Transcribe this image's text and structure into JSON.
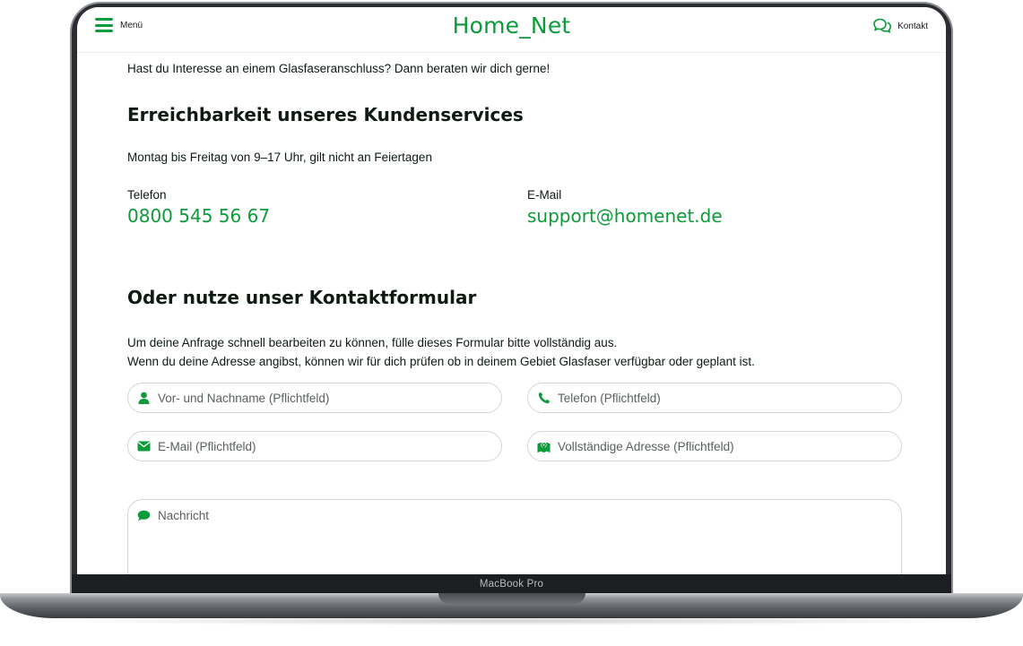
{
  "device": {
    "model_label": "MacBook Pro"
  },
  "header": {
    "menu_label": "Menü",
    "logo": "Home_Net",
    "contact_label": "Kontakt",
    "menu_icon": "hamburger-icon",
    "contact_icon": "chat-bubbles-icon"
  },
  "intro_text": "Hast du Interesse an einem Glasfaseranschluss? Dann beraten wir dich gerne!",
  "service": {
    "heading": "Erreichbarkeit unseres Kundenservices",
    "hours": "Montag bis Freitag von 9–17 Uhr, gilt nicht an Feiertagen",
    "phone_caption": "Telefon",
    "phone_value": "0800 545 56 67",
    "email_caption": "E-Mail",
    "email_value": "support@homenet.de"
  },
  "form": {
    "heading": "Oder nutze unser Kontaktformular",
    "description_line1": "Um deine Anfrage schnell bearbeiten zu können, fülle dieses Formular bitte vollständig aus.",
    "description_line2": "Wenn du deine Adresse angibst, können wir für dich prüfen ob in deinem Gebiet Glasfaser verfügbar oder geplant ist.",
    "fields": [
      {
        "placeholder": "Vor- und Nachname (Pflichtfeld)",
        "icon": "user-icon",
        "value": ""
      },
      {
        "placeholder": "Telefon (Pflichtfeld)",
        "icon": "phone-icon",
        "value": ""
      },
      {
        "placeholder": "E-Mail (Pflichtfeld)",
        "icon": "envelope-icon",
        "value": ""
      },
      {
        "placeholder": "Vollständige Adresse (Pflichtfeld)",
        "icon": "map-pin-icon",
        "value": ""
      }
    ],
    "message": {
      "placeholder": "Nachricht",
      "icon": "speech-bubble-icon",
      "value": ""
    }
  },
  "colors": {
    "brand": "#0d9a3a",
    "text": "#0e1a12",
    "field_border": "#d3d6d4"
  }
}
